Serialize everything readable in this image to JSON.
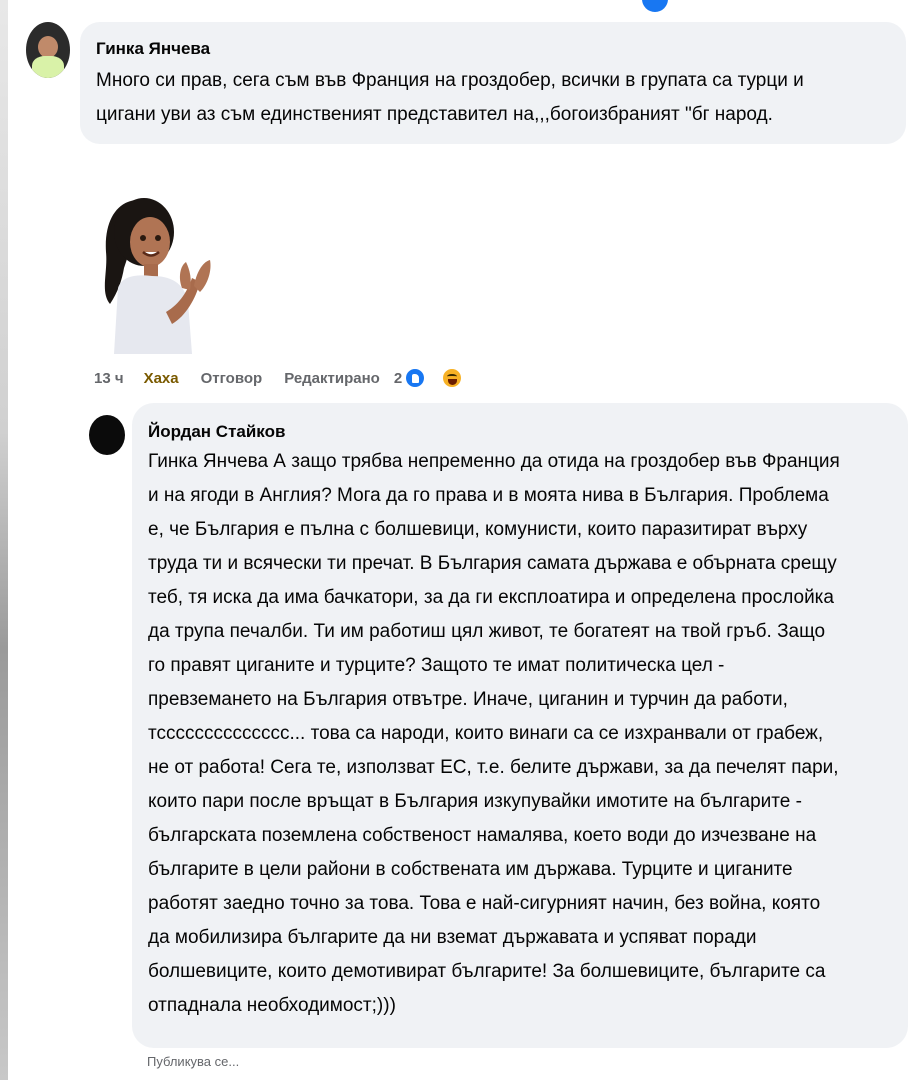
{
  "comments": [
    {
      "author": "Гинка Янчева",
      "lines": [
        "Много си прав, сега съм във Франция на гроздобер, всички в групата са турци и",
        "цигани уви аз съм единственият представител на,,,богоизбраният \"бг народ."
      ],
      "sticker": "woman-clapping-sticker",
      "actions": {
        "time": "13 ч",
        "reaction_label": "Хаха",
        "reply_label": "Отговор",
        "edited_label": "Редактирано",
        "reactions_count": "2"
      }
    },
    {
      "author": "Йордан Стайков",
      "lines": [
        "Гинка Янчева А защо трябва непременно да отида на гроздобер във Франция",
        "и на ягоди в Англия? Мога да го права и в моята нива в България. Проблема",
        "е, че България е пълна с болшевици, комунисти, които паразитират върху",
        "труда ти и всячески ти пречат. В България самата държава е обърната срещу",
        "теб, тя иска да има бачкатори, за да ги експлоатира и определена прослойка",
        "да трупа печалби. Ти им работиш цял живот, те богатеят на твой гръб. Защо",
        "го правят циганите и турците? Защото те имат политическа цел -",
        "превземането на България отвътре. Иначе, циганин и турчин да работи,",
        "тсссссссссссссс... това са народи, които винаги са се изхранвали от грабеж,",
        "не от работа! Сега те, използват ЕС, т.е. белите държави, за да печелят пари,",
        "които пари после връщат в България изкупувайки имотите на българите -",
        "българската поземлена собственост намалява, което води до изчезване на",
        "българите в цели райони в собствената им държава. Турците и циганите",
        "работят заедно точно за това. Това е най-сигурният начин, без война, която",
        "да мобилизира българите да ни вземат държавата и успяват поради",
        "болшевиците, които демотивират българите! За болшевиците, българите са",
        "отпаднала необходимост;)))"
      ],
      "status": "Публикува се..."
    }
  ],
  "colors": {
    "bubble": "#f0f2f5",
    "meta_text": "#65676b",
    "like": "#1877f2",
    "haha": "#f7b125"
  }
}
